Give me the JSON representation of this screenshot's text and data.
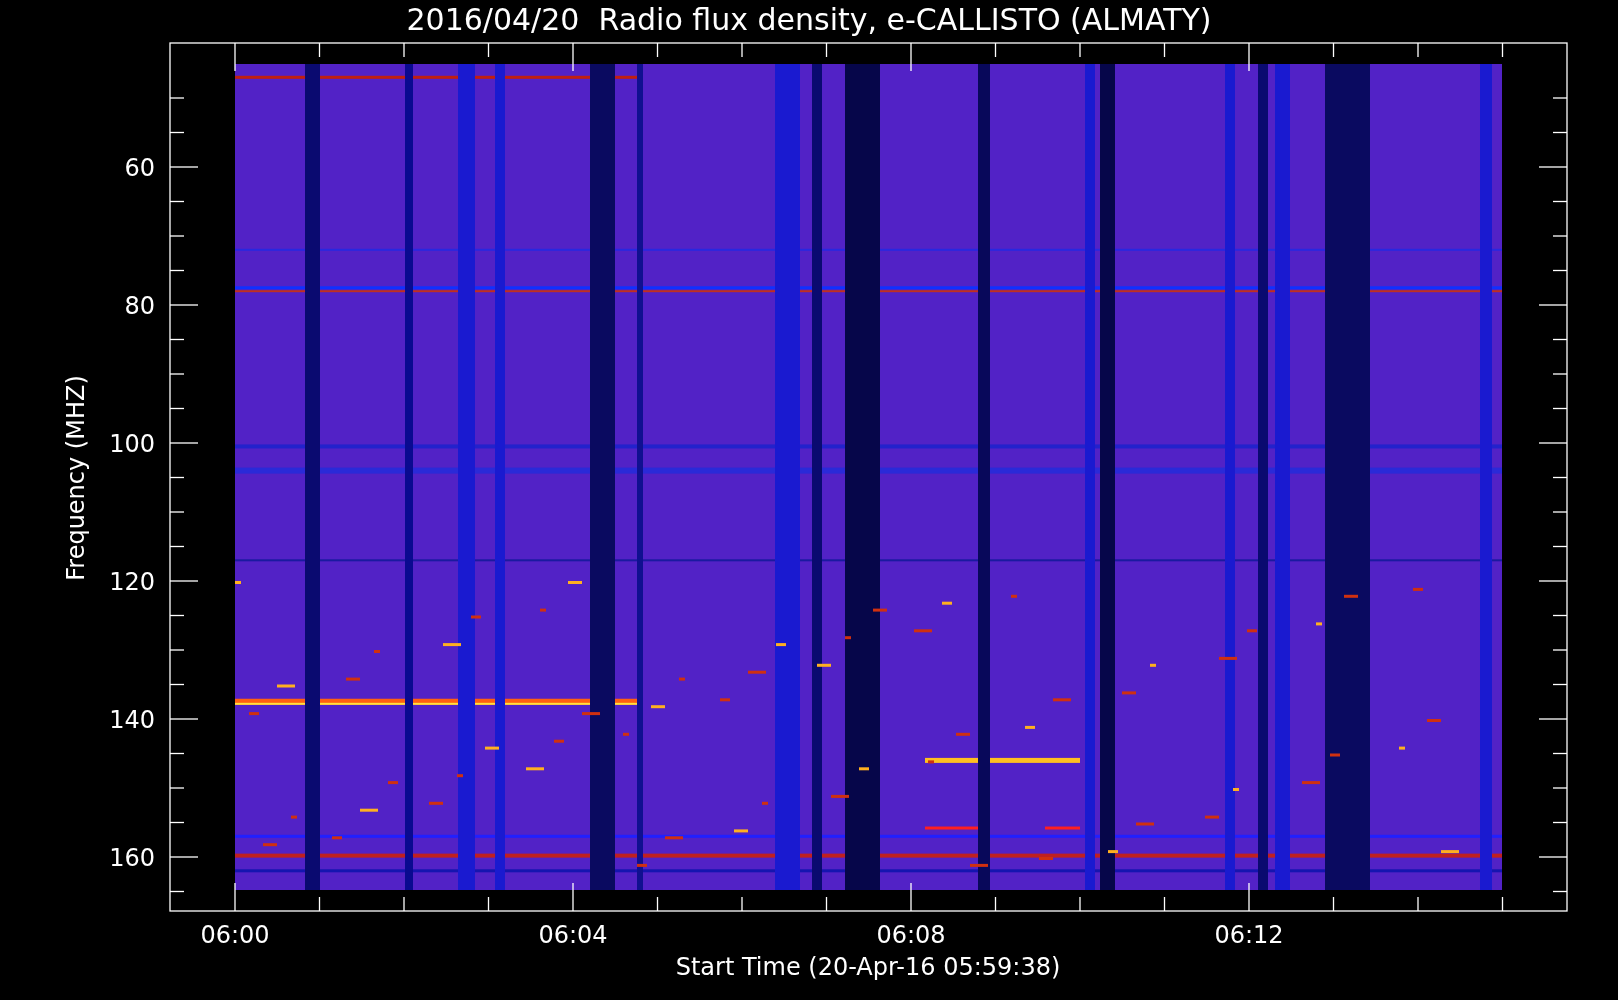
{
  "title": "2016/04/20  Radio flux density, e-CALLISTO (ALMATY)",
  "y_axis": {
    "label": "Frequency (MHZ)",
    "ticks": [
      "60",
      "80",
      "100",
      "120",
      "140",
      "160"
    ]
  },
  "x_axis": {
    "label": "Start Time (20-Apr-16 05:59:38)",
    "ticks": [
      "06:00",
      "06:04",
      "06:08",
      "06:12"
    ]
  }
}
